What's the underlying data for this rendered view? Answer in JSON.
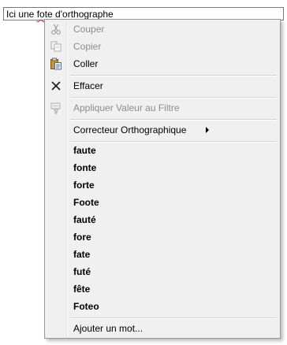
{
  "field": {
    "text_before": "Ici une ",
    "misspelled_word": "fote",
    "text_after": " d'orthographe"
  },
  "menu": {
    "cut_label": "Couper",
    "copy_label": "Copier",
    "paste_label": "Coller",
    "clear_label": "Effacer",
    "apply_filter_label": "Appliquer Valeur au Filtre",
    "spell_checker_label": "Correcteur Orthographique",
    "suggestions": [
      "faute",
      "fonte",
      "forte",
      "Foote",
      "fauté",
      "fore",
      "fate",
      "futé",
      "fête",
      "Foteo"
    ],
    "add_word_label": "Ajouter un mot..."
  }
}
